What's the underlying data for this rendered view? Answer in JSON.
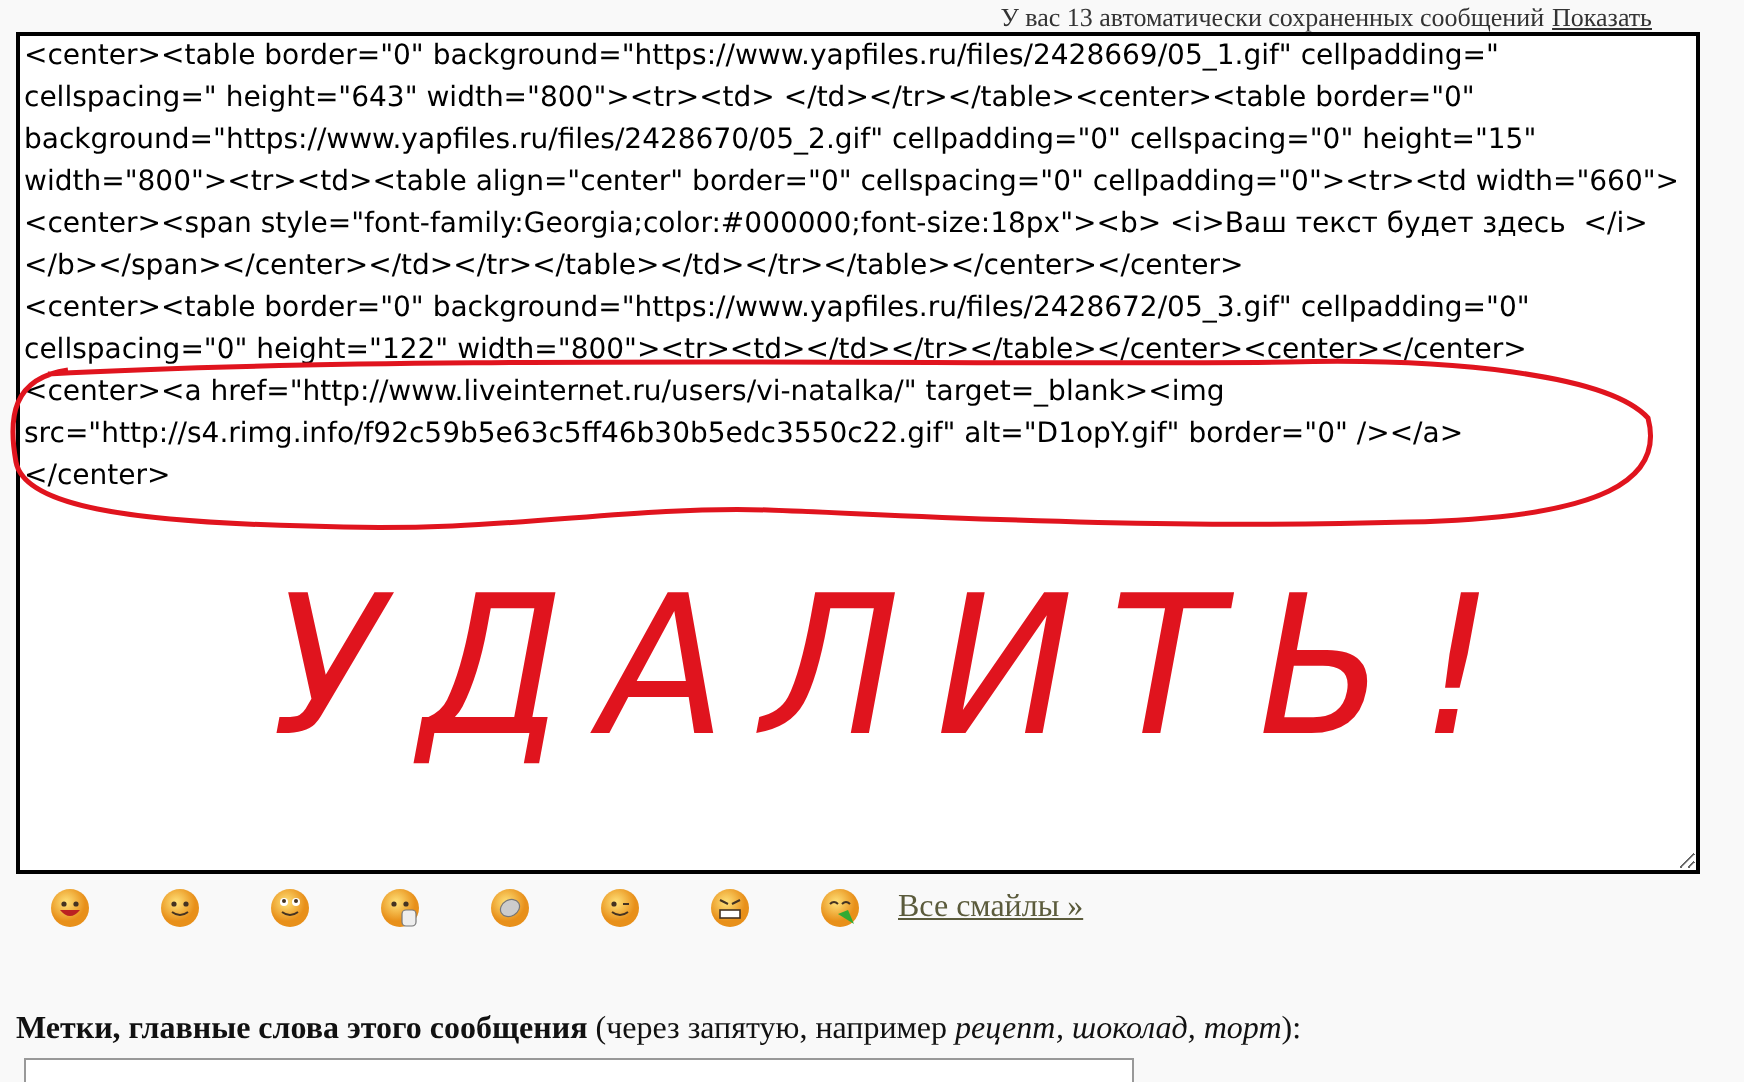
{
  "autosave_notice": {
    "text": "У вас 13 автоматически сохраненных сообщений",
    "link": "Показать"
  },
  "editor": {
    "value": "<center><table border=\"0\" background=\"https://www.yapfiles.ru/files/2428669/05_1.gif\" cellpadding=\" cellspacing=\" height=\"643\" width=\"800\"><tr><td> </td></tr></table><center><table border=\"0\" background=\"https://www.yapfiles.ru/files/2428670/05_2.gif\" cellpadding=\"0\" cellspacing=\"0\" height=\"15\" width=\"800\"><tr><td><table align=\"center\" border=\"0\" cellspacing=\"0\" cellpadding=\"0\"><tr><td width=\"660\"><center><span style=\"font-family:Georgia;color:#000000;font-size:18px\"><b> <i>Ваш текст будет здесь  </i></b></span></center></td></tr></table></td></tr></table></center></center>\n<center><table border=\"0\" background=\"https://www.yapfiles.ru/files/2428672/05_3.gif\" cellpadding=\"0\" cellspacing=\"0\" height=\"122\" width=\"800\"><tr><td></td></tr></table></center><center></center>\n<center><a href=\"http://www.liveinternet.ru/users/vi-natalka/\" target=_blank><img src=\"http://s4.rimg.info/f92c59b5e63c5ff46b30b5edc3550c22.gif\" alt=\"D1opY.gif\" border=\"0\" /></a>\n</center>"
  },
  "annotation": {
    "text": "УДАЛИТЬ!"
  },
  "smileys_link": "Все смайлы »",
  "tags": {
    "label": "**Метки, главные слова этого сообщения** (через запятую, например *рецепт, шоколад, торт*):"
  }
}
